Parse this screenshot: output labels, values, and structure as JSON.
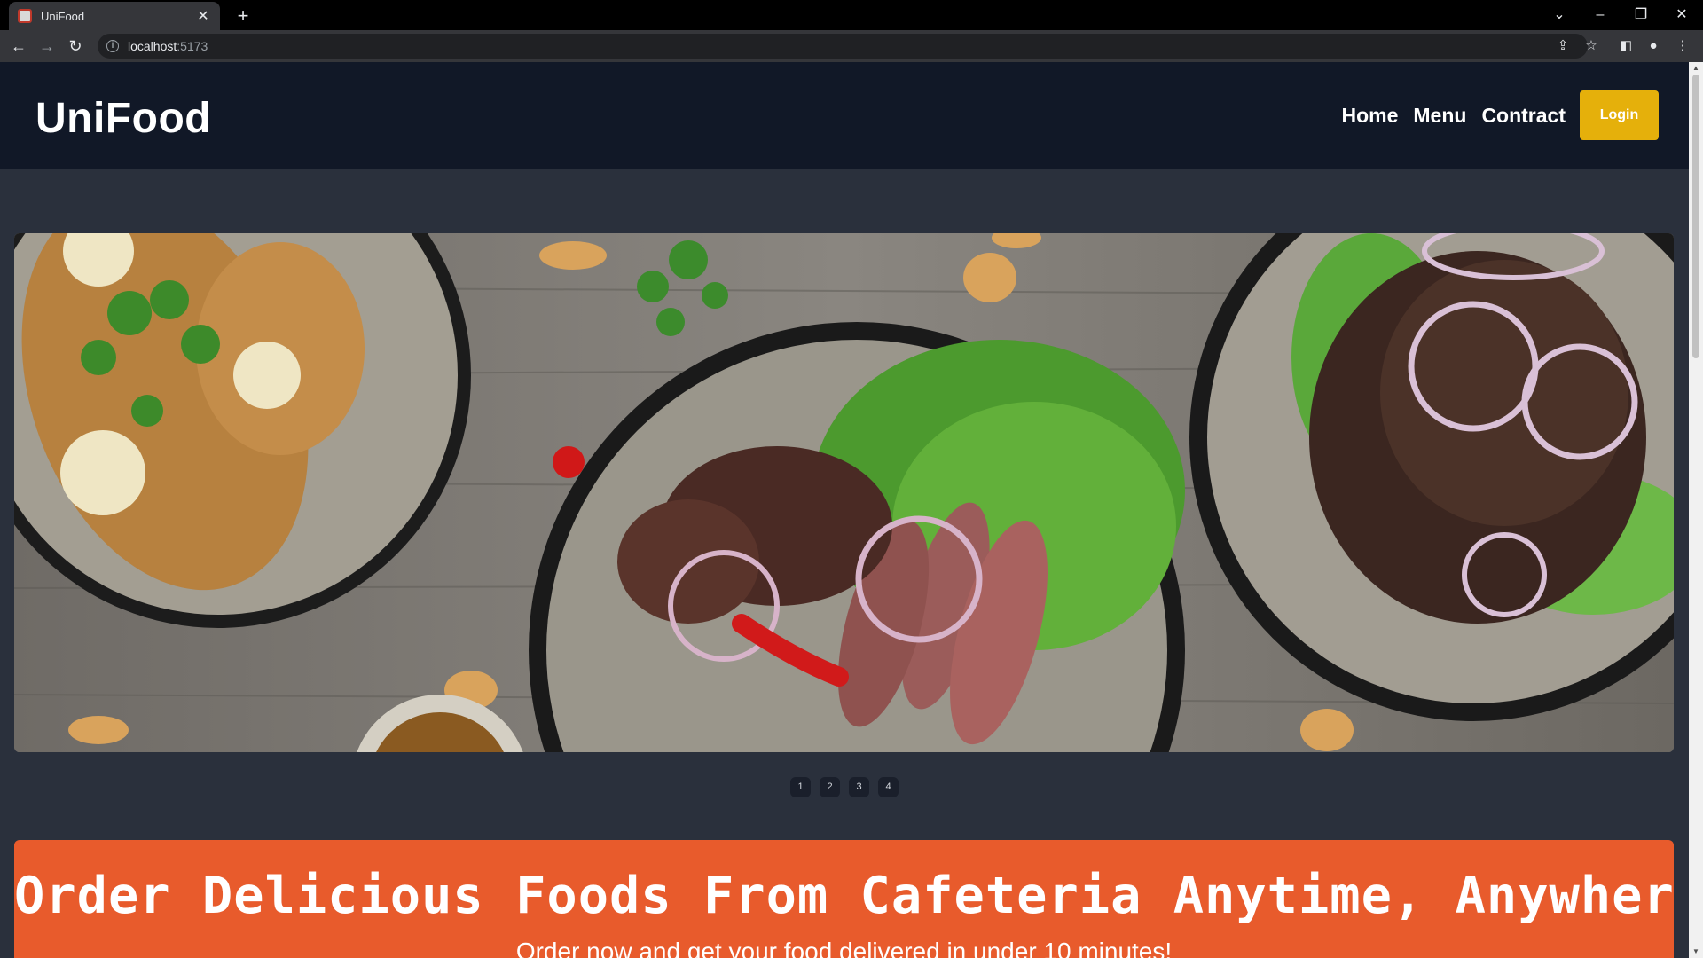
{
  "browser": {
    "tab_title": "UniFood",
    "new_tab_symbol": "+",
    "url_host": "localhost",
    "url_port": ":5173"
  },
  "site": {
    "brand": "UniFood",
    "nav": [
      "Home",
      "Menu",
      "Contract"
    ],
    "login_label": "Login"
  },
  "carousel": {
    "indicators": [
      "1",
      "2",
      "3",
      "4"
    ]
  },
  "banner": {
    "title": "Order Delicious Foods From Cafeteria Anytime, Anywhere",
    "subtitle": "Order now and get your food delivered in under 10 minutes!"
  },
  "colors": {
    "header_bg": "#111827",
    "page_bg": "#2a303c",
    "accent_login": "#e5b00b",
    "banner_bg": "#e85b2c"
  },
  "icons": {
    "back": "arrow-left-icon",
    "forward": "arrow-right-icon",
    "reload": "reload-icon",
    "info": "info-icon",
    "share": "share-icon",
    "bookmark": "star-icon",
    "sidepanel": "side-panel-icon",
    "profile": "profile-icon",
    "menu": "kebab-menu-icon"
  }
}
